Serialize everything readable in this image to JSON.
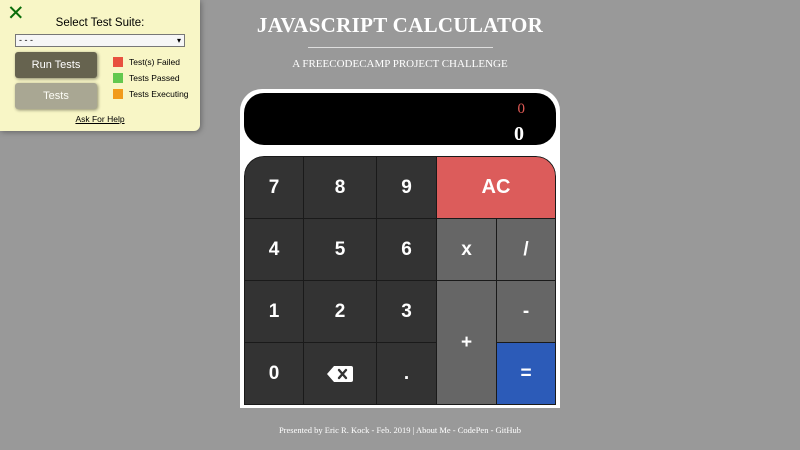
{
  "test_panel": {
    "close_glyph": "✕",
    "suite_label": "Select Test Suite:",
    "suite_selected": "- - -",
    "run_button": "Run Tests",
    "tests_button": "Tests",
    "legend": [
      {
        "label": "Test(s) Failed",
        "color": "#e8513f"
      },
      {
        "label": "Tests Passed",
        "color": "#63c84e"
      },
      {
        "label": "Tests Executing",
        "color": "#f19b1c"
      }
    ],
    "help_link": "Ask For Help"
  },
  "header": {
    "title": "JAVASCRIPT CALCULATOR",
    "subtitle": "A FREECODECAMP PROJECT CHALLENGE"
  },
  "calculator": {
    "formula": "0",
    "output": "0",
    "keys": {
      "seven": "7",
      "eight": "8",
      "nine": "9",
      "clear": "AC",
      "four": "4",
      "five": "5",
      "six": "6",
      "multiply": "x",
      "divide": "/",
      "one": "1",
      "two": "2",
      "three": "3",
      "add": "+",
      "subtract": "-",
      "zero": "0",
      "decimal": ".",
      "equals": "="
    },
    "colors": {
      "number_key": "#333333",
      "operator_key": "#666666",
      "clear_key": "#dc5c5b",
      "equals_key": "#2c5bb8",
      "formula_text": "#e05a55"
    }
  },
  "footer": {
    "presented": "Presented by Eric R. Kock - Feb. 2019",
    "sep": " | ",
    "about": "About Me",
    "dash1": " - ",
    "codepen": "CodePen",
    "dash2": " - ",
    "github": "GitHub"
  }
}
